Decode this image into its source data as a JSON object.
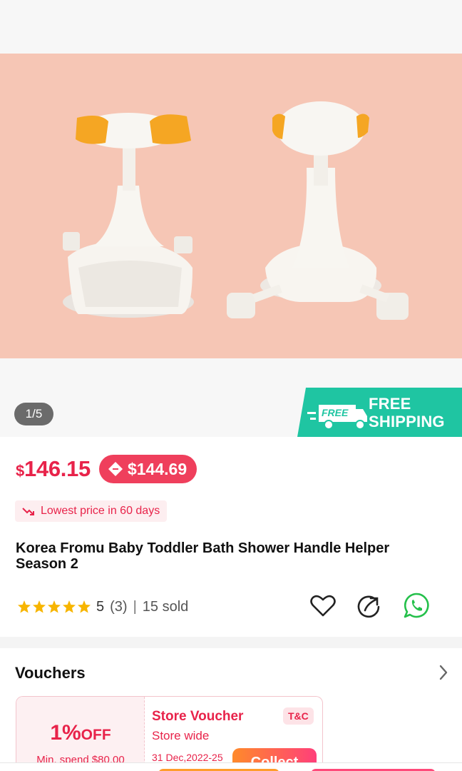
{
  "gallery": {
    "counter": "1/5",
    "background_color": "#f6c6b5",
    "image_desc_icon": "product-photo",
    "shipping_badge": {
      "tag": "FREE",
      "line1": "FREE",
      "line2": "SHIPPING",
      "color": "#1fc5a2"
    }
  },
  "price": {
    "currency": "$",
    "amount": "146.15",
    "voucher_price": "$144.69",
    "voucher_icon": "voucher-tag-icon",
    "accent": "#e8234a"
  },
  "lowest_badge": {
    "text": "Lowest price in 60 days",
    "icon": "trend-down-icon"
  },
  "product": {
    "title": "Korea Fromu Baby Toddler Bath Shower Handle Helper Season 2"
  },
  "meta": {
    "stars": 5,
    "rating": "5",
    "reviews": "(3)",
    "separator": "|",
    "sold": "15 sold"
  },
  "actions": [
    "heart-icon",
    "share-icon",
    "whatsapp-icon"
  ],
  "vouchers": {
    "title": "Vouchers",
    "card": {
      "percent": "1%",
      "off": "OFF",
      "min_spend": "Min. spend $80.00",
      "name": "Store Voucher",
      "scope": "Store wide",
      "date": "31 Dec,2022-25",
      "tc": "T&C",
      "collect": "Collect"
    }
  }
}
